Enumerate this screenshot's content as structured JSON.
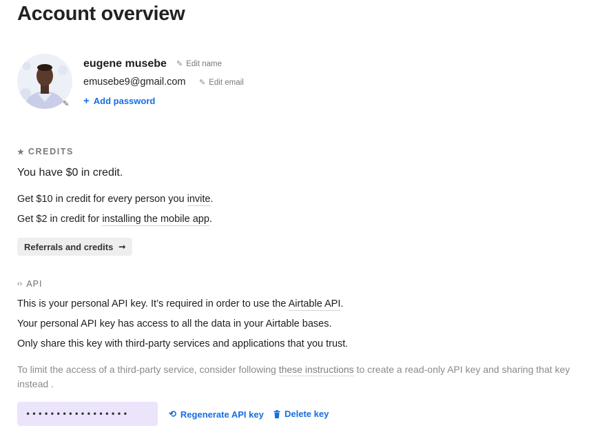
{
  "page": {
    "title": "Account overview"
  },
  "profile": {
    "name": "eugene musebe",
    "edit_name": "Edit name",
    "email": "emusebe9@gmail.com",
    "edit_email": "Edit email",
    "add_password": "Add password"
  },
  "credits": {
    "heading": "CREDITS",
    "balance": "You have $0 in credit.",
    "invite_prefix": "Get $10 in credit for every person you",
    "invite_link": "invite",
    "invite_suffix": ".",
    "mobile_prefix": "Get $2 in credit for",
    "mobile_link": "installing the mobile app",
    "mobile_suffix": ".",
    "button_label": "Referrals and credits"
  },
  "api": {
    "heading": "API",
    "line1_prefix": "This is your personal API key. It’s required in order to use the",
    "line1_link": "Airtable API",
    "line1_suffix": ".",
    "line2": "Your personal API key has access to all the data in your Airtable bases.",
    "line3": "Only share this key with third-party services and applications that you trust.",
    "note_prefix": "To limit the access of a third-party service, consider following",
    "note_link": "these instructions",
    "note_suffix": "to create a read-only API key and sharing that key instead .",
    "key_masked": "•••••••••••••••••",
    "regenerate": "Regenerate API key",
    "delete": "Delete key"
  },
  "colors": {
    "link": "#166ee1",
    "key_bg": "#ece4fb",
    "button_bg": "#eeeeee"
  },
  "icons": [
    "pencil-icon",
    "plus-icon",
    "star-icon",
    "code-icon",
    "arrow-right-icon",
    "refresh-icon",
    "trash-icon"
  ]
}
